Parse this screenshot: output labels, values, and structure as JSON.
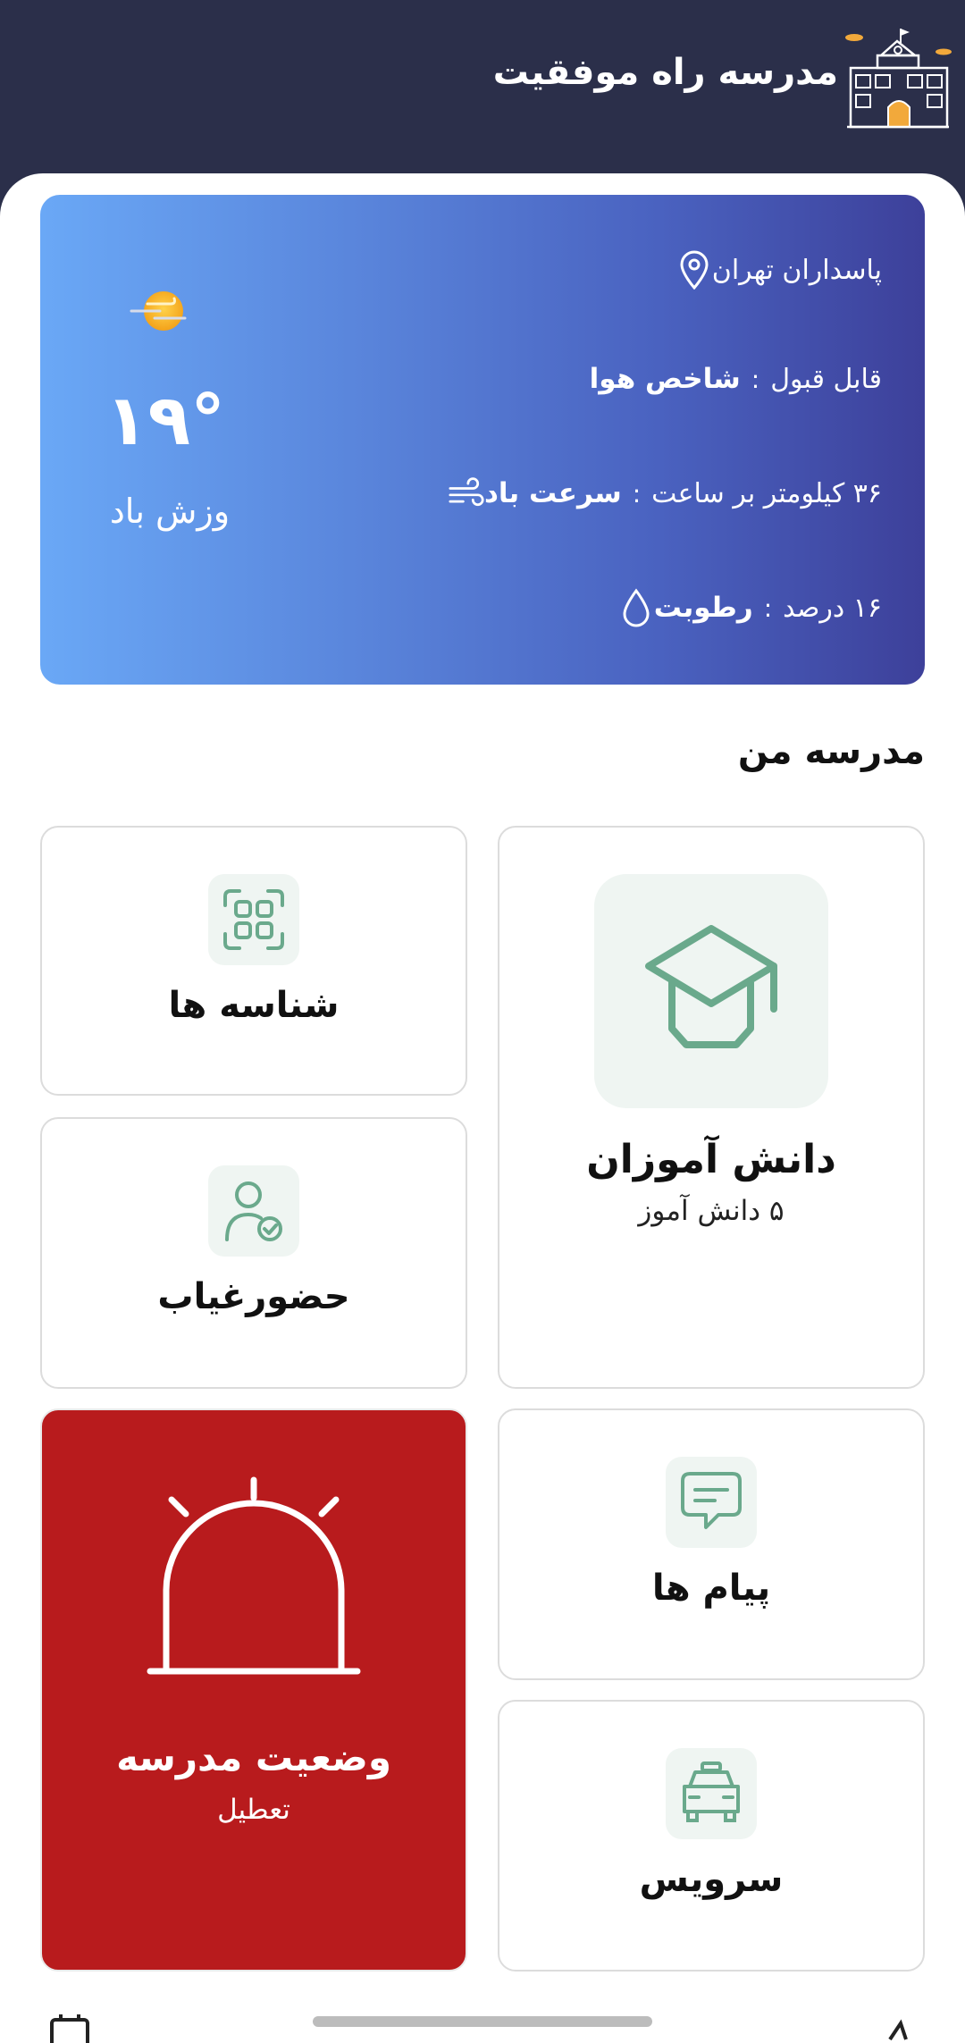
{
  "header": {
    "title": "مدرسه راه موفقیت",
    "logo_icon": "school-building-icon"
  },
  "weather": {
    "location": "پاسداران تهران",
    "aqi_label": "شاخص هوا",
    "aqi_value": "قابل قبول",
    "wind_label": "سرعت باد",
    "wind_value": "۳۶ کیلومتر بر ساعت",
    "humidity_label": "رطوبت",
    "humidity_value": "۱۶ درصد",
    "separator": ":",
    "temperature": "۱۹°",
    "condition": "وزش باد",
    "gradient_start": "#6aa8f6",
    "gradient_end": "#3d409a"
  },
  "section": {
    "title": "مدرسه من"
  },
  "tiles": {
    "students": {
      "label": "دانش آموزان",
      "sub": "۵ دانش آموز",
      "icon": "graduation-cap-icon"
    },
    "ids": {
      "label": "شناسه ها",
      "icon": "id-grid-icon"
    },
    "attendance": {
      "label": "حضورغیاب",
      "icon": "user-check-icon"
    },
    "messages": {
      "label": "پیام ها",
      "icon": "message-icon"
    },
    "service": {
      "label": "سرویس",
      "icon": "car-icon"
    },
    "school_status": {
      "label": "وضعیت مدرسه",
      "sub": "تعطیل",
      "icon": "alarm-light-icon",
      "color": "#b81b1d"
    }
  },
  "colors": {
    "header_bg": "#2b2f4a",
    "icon_green": "#6aa98c",
    "icon_bg": "#eff5f2"
  }
}
